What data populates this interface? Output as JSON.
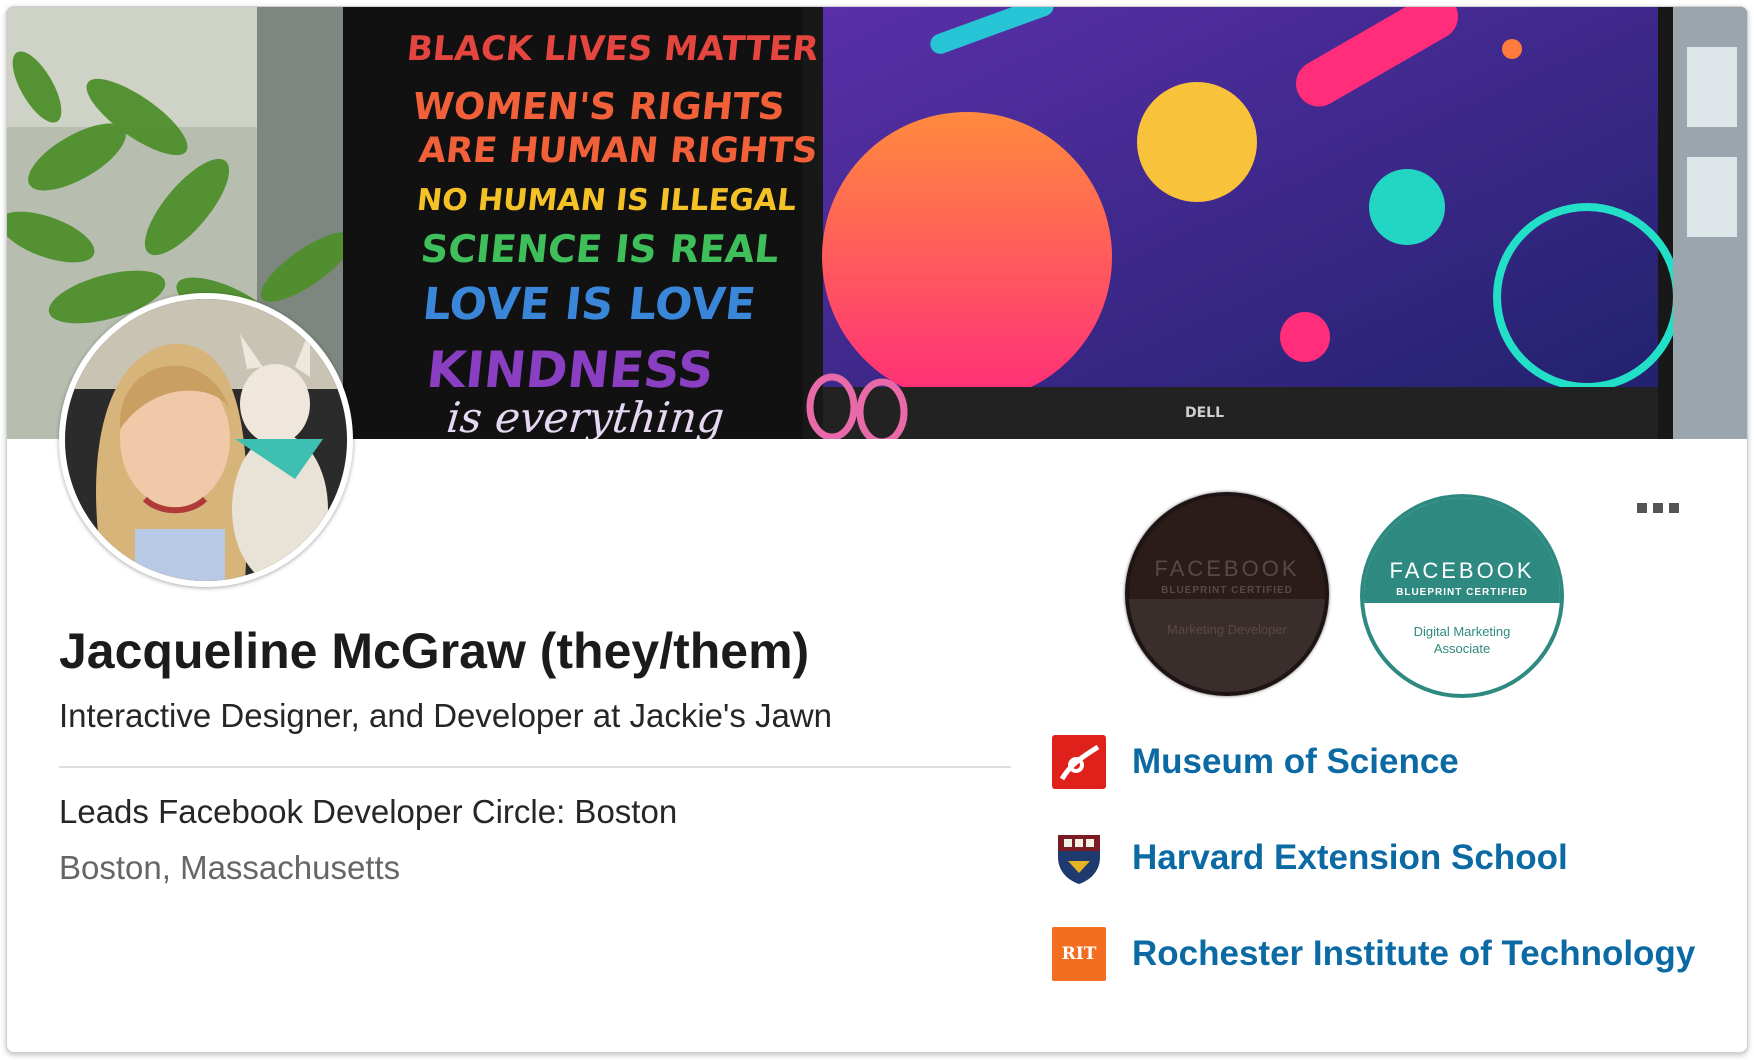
{
  "cover": {
    "poster_lines": [
      {
        "text": "BLACK LIVES MATTER",
        "color": "#e4463f"
      },
      {
        "text": "WOMEN'S RIGHTS",
        "color": "#f2603a"
      },
      {
        "text": "ARE HUMAN RIGHTS",
        "color": "#f2603a"
      },
      {
        "text": "NO HUMAN IS ILLEGAL",
        "color": "#f4c127"
      },
      {
        "text": "SCIENCE IS REAL",
        "color": "#3fbf5a"
      },
      {
        "text": "LOVE IS LOVE",
        "color": "#3a86d8"
      },
      {
        "text": "KINDNESS",
        "color": "#8a3fc2"
      },
      {
        "text": "is everything",
        "color": "#9a5fd2"
      }
    ],
    "monitor_brand": "DELL"
  },
  "profile": {
    "name": "Jacqueline McGraw (they/them)",
    "headline": "Interactive Designer, and Developer at Jackie's Jawn",
    "about": "Leads Facebook Developer Circle: Boston",
    "location": "Boston, Massachusetts"
  },
  "badges": [
    {
      "title": "FACEBOOK",
      "subtitle": "BLUEPRINT CERTIFIED",
      "role": "Marketing Developer",
      "state": "dimmed"
    },
    {
      "title": "FACEBOOK",
      "subtitle": "BLUEPRINT CERTIFIED",
      "role": "Digital Marketing Associate",
      "state": "active"
    }
  ],
  "organizations": [
    {
      "name": "Museum of Science",
      "icon": "museum-of-science-logo",
      "color": "#e0201a"
    },
    {
      "name": "Harvard Extension School",
      "icon": "harvard-shield-logo",
      "color": "#7a1a22"
    },
    {
      "name": "Rochester Institute of Technology",
      "icon": "rit-logo",
      "logo_text": "RIT",
      "color": "#f36e21"
    }
  ],
  "colors": {
    "link": "#0b6aa3",
    "text": "#1b1b1b",
    "muted": "#666666"
  }
}
